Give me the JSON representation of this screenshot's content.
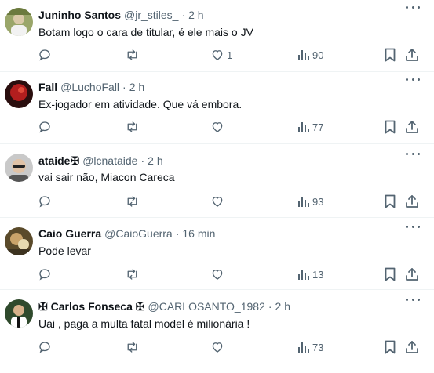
{
  "posts": [
    {
      "name": "Juninho Santos",
      "handle": "@jr_stiles_",
      "dot": "·",
      "time": "2 h",
      "text": "Botam logo o cara de titular, é ele mais o JV",
      "likes": "1",
      "views": "90",
      "avatar_color": "#6b7a3e"
    },
    {
      "name": "Fall",
      "handle": "@LuchoFall",
      "dot": "·",
      "time": "2 h",
      "text": "Ex-jogador em atividade. Que vá embora.",
      "likes": "",
      "views": "77",
      "avatar_color": "#b21e1e"
    },
    {
      "name": "ataide✠",
      "handle": "@lcnataide",
      "dot": "·",
      "time": "2 h",
      "text": "vai sair não, Miacon Careca",
      "likes": "",
      "views": "93",
      "avatar_color": "#8a8a8a"
    },
    {
      "name": "Caio Guerra",
      "handle": "@CaioGuerra",
      "dot": "·",
      "time": "16 min",
      "text": "Pode levar",
      "likes": "",
      "views": "13",
      "avatar_color": "#7a6a3a"
    },
    {
      "name": "✠ Carlos Fonseca ✠",
      "handle": "@CARLOSANTO_1982",
      "dot": "·",
      "time": "2 h",
      "text": "Uai , paga a multa fatal model é milionária !",
      "likes": "",
      "views": "73",
      "avatar_color": "#3f6f3a"
    }
  ],
  "icons": {
    "reply": "reply-icon",
    "repost": "repost-icon",
    "like": "heart-icon",
    "views": "views-icon",
    "bookmark": "bookmark-icon",
    "share": "share-icon",
    "more": "more-icon"
  },
  "colors": {
    "text_primary": "#0f1419",
    "text_secondary": "#536471",
    "divider": "#eff3f4"
  }
}
